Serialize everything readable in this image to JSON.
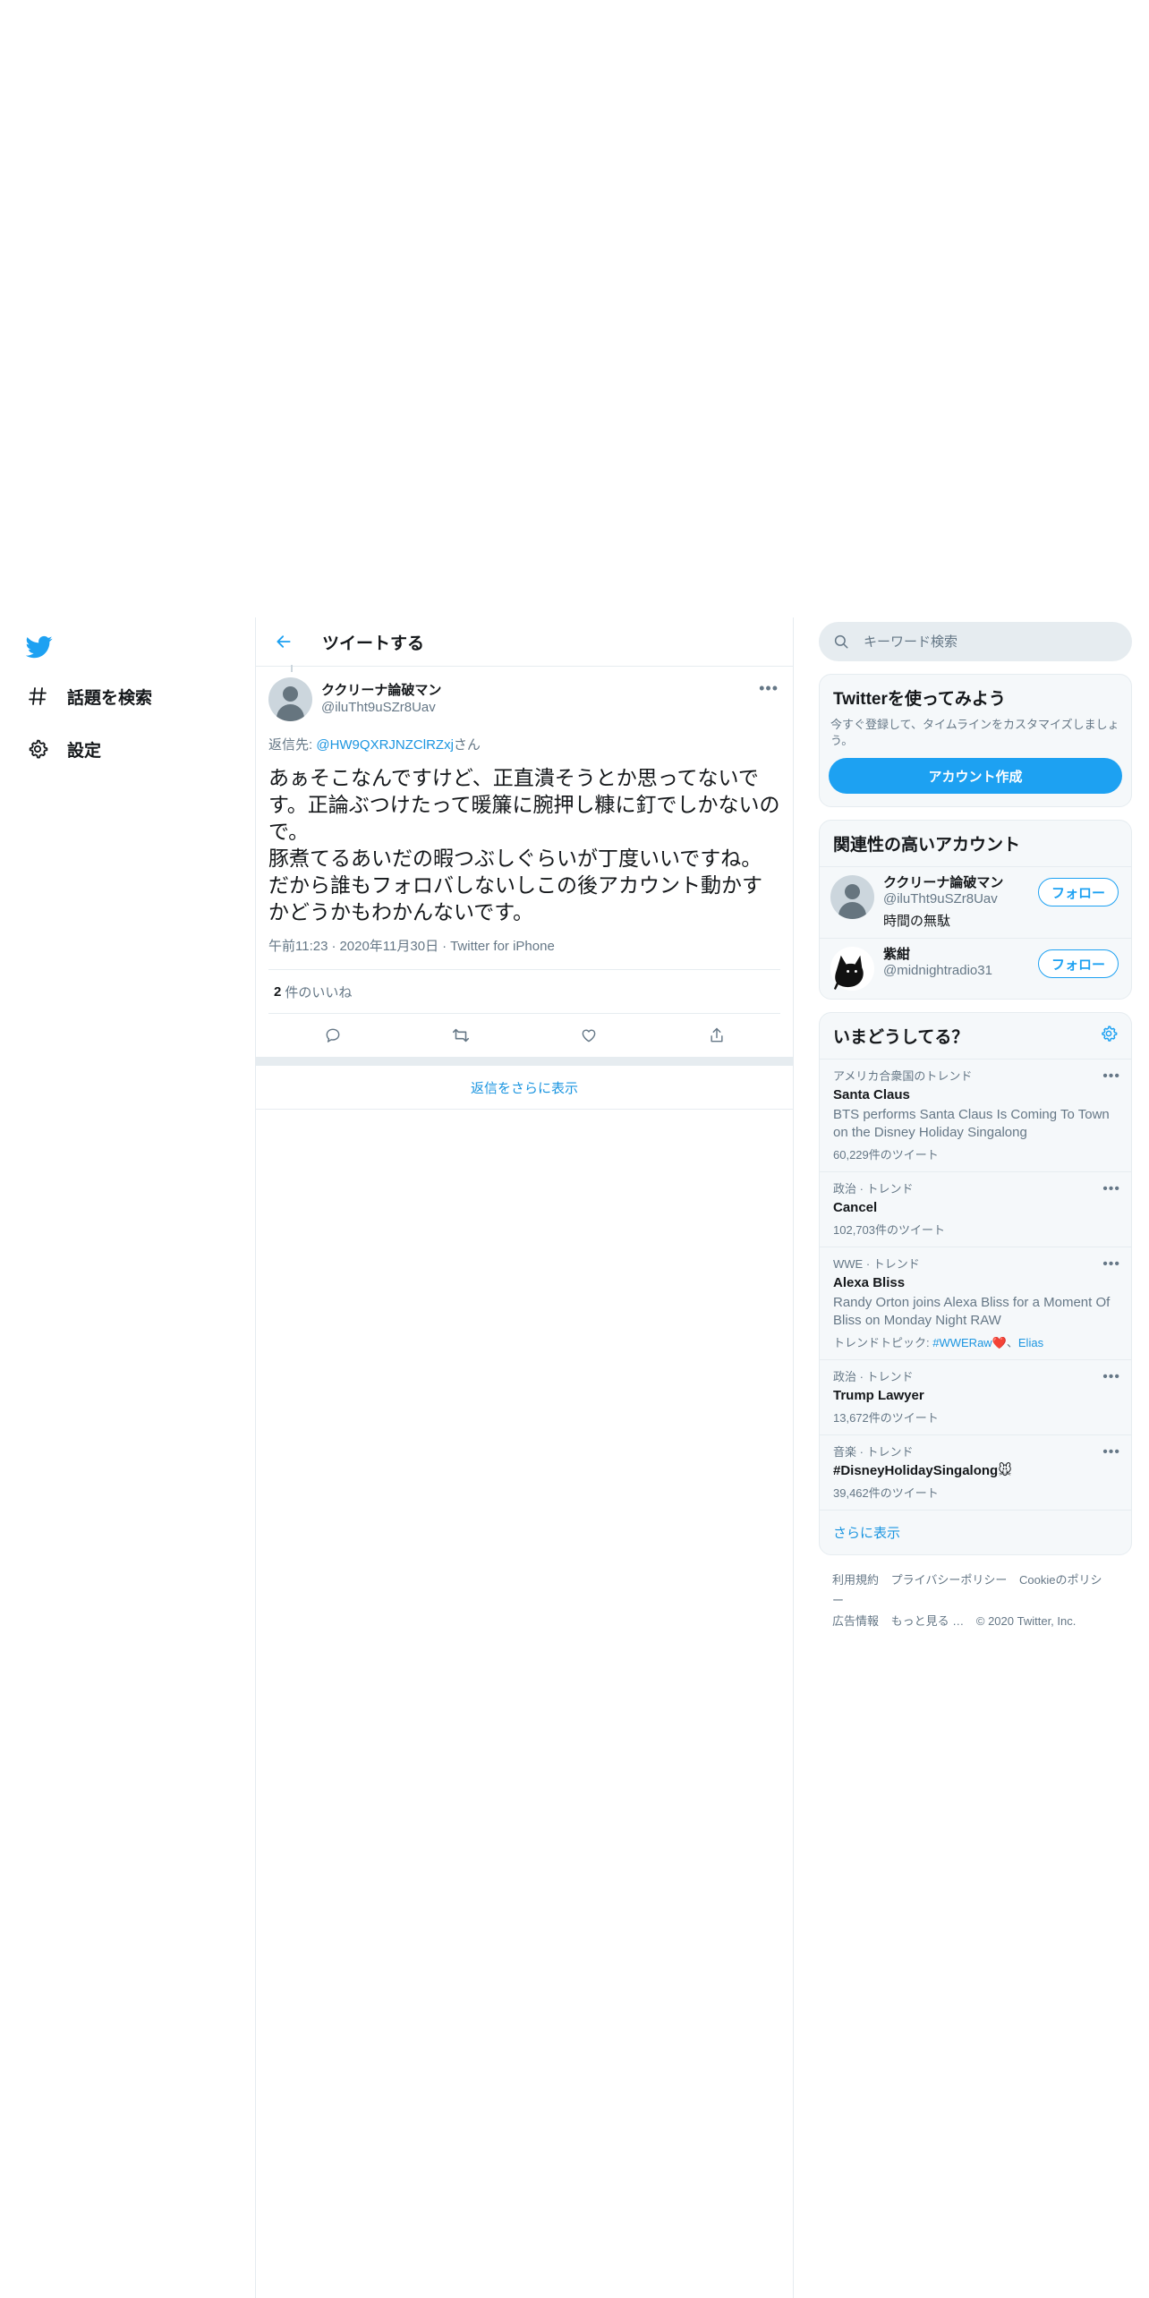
{
  "colors": {
    "accent": "#1da1f2",
    "link": "#1b95e0",
    "secondary_text": "#657786",
    "border": "#e6ecf0"
  },
  "left_nav": {
    "logo_icon": "twitter-bird-icon",
    "items": [
      {
        "label": "話題を検索",
        "icon": "hashtag-icon"
      },
      {
        "label": "設定",
        "icon": "gear-icon"
      }
    ]
  },
  "header": {
    "title": "ツイートする",
    "back_icon": "arrow-left-icon"
  },
  "tweet": {
    "author_name": "ククリーナ論破マン",
    "author_handle": "@iluTht9uSZr8Uav",
    "reply_prefix": "返信先: ",
    "reply_to": "@HW9QXRJNZClRZxj",
    "reply_suffix": "さん",
    "text": "あぁそこなんですけど、正直潰そうとか思ってないです。正論ぶつけたって暖簾に腕押し糠に釘でしかないので。\n豚煮てるあいだの暇つぶしぐらいが丁度いいですね。だから誰もフォロバしないしこの後アカウント動かすかどうかもわかんないです。",
    "time": "午前11:23",
    "date": "2020年11月30日",
    "source": "Twitter for iPhone",
    "like_count": "2",
    "like_label": "件のいいね",
    "show_more_replies": "返信をさらに表示"
  },
  "search": {
    "placeholder": "キーワード検索"
  },
  "signup": {
    "title": "Twitterを使ってみよう",
    "desc": "今すぐ登録して、タイムラインをカスタマイズしましょう。",
    "button": "アカウント作成"
  },
  "related": {
    "title": "関連性の高いアカウント",
    "accounts": [
      {
        "name": "ククリーナ論破マン",
        "handle": "@iluTht9uSZr8Uav",
        "bio": "時間の無駄",
        "follow": "フォロー"
      },
      {
        "name": "紫紺",
        "handle": "@midnightradio31",
        "bio": "",
        "follow": "フォロー"
      }
    ]
  },
  "trends": {
    "title": "いまどうしてる？",
    "items": [
      {
        "context": "アメリカ合衆国のトレンド",
        "name": "Santa Claus",
        "desc": "BTS performs Santa Claus Is Coming To Town on the Disney Holiday Singalong",
        "count": "60,229件のツイート"
      },
      {
        "context": "政治 · トレンド",
        "name": "Cancel",
        "count": "102,703件のツイート"
      },
      {
        "context": "WWE · トレンド",
        "name": "Alexa Bliss",
        "desc": "Randy Orton joins Alexa Bliss for a Moment Of Bliss on Monday Night RAW",
        "topics_label": "トレンドトピック: ",
        "topic1": "#WWERaw❤️",
        "topic2": "Elias"
      },
      {
        "context": "政治 · トレンド",
        "name": "Trump Lawyer",
        "count": "13,672件のツイート"
      },
      {
        "context": "音楽 · トレンド",
        "name": "#DisneyHolidaySingalong🐭",
        "count": "39,462件のツイート"
      }
    ],
    "show_more": "さらに表示"
  },
  "footer": {
    "links": [
      "利用規約",
      "プライバシーポリシー",
      "Cookieのポリシー",
      "広告情報",
      "もっと見る …"
    ],
    "copyright": "© 2020 Twitter, Inc."
  }
}
